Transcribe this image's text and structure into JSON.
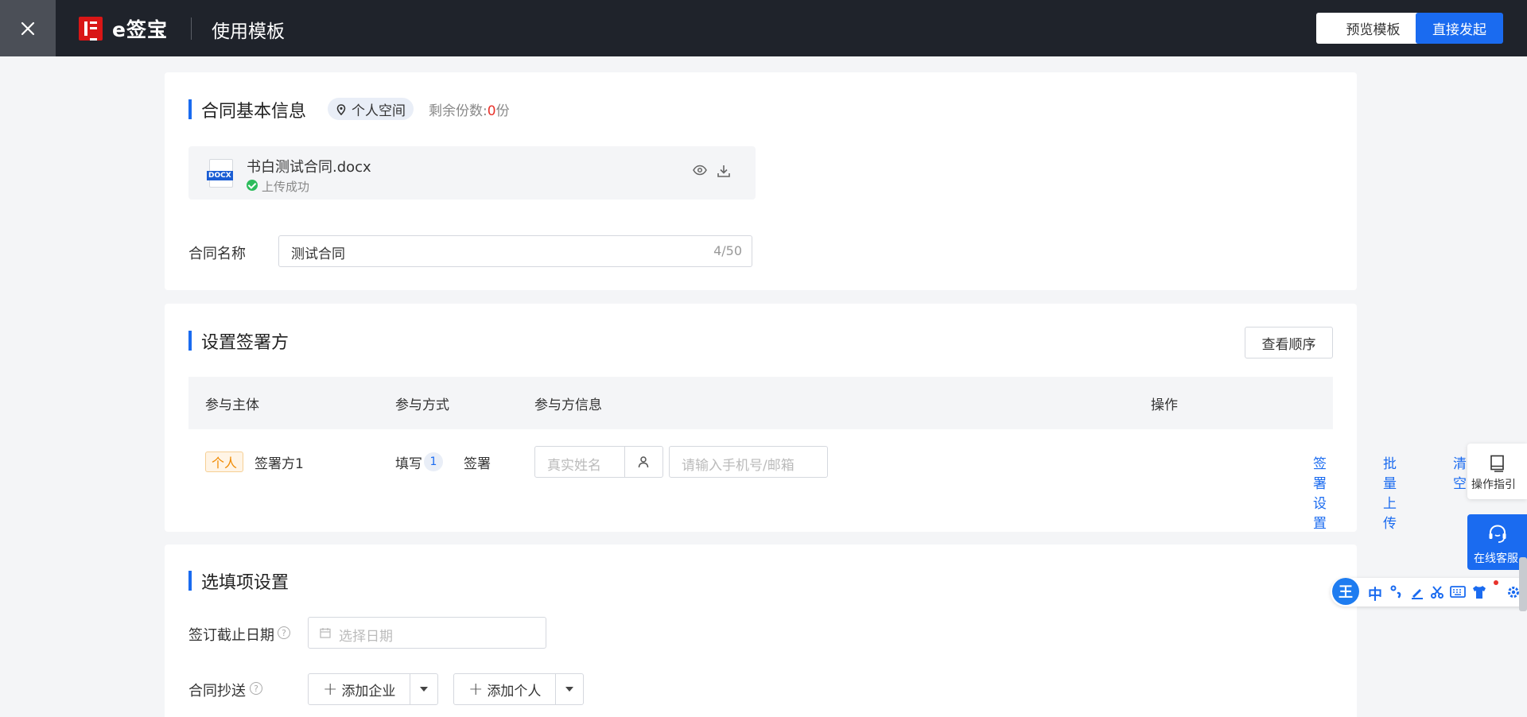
{
  "header": {
    "brand": "e签宝",
    "page_title": "使用模板",
    "preview_label": "预览模板",
    "send_label": "直接发起"
  },
  "basic_info": {
    "title": "合同基本信息",
    "space_tag": "个人空间",
    "remain_label": "剩余份数:",
    "remain_count": "0",
    "remain_unit": "份",
    "file": {
      "icon_label": "DOCX",
      "name": "书白测试合同.docx",
      "status": "上传成功"
    },
    "contract_name_label": "合同名称",
    "contract_name_value": "测试合同",
    "contract_name_count": "4/50"
  },
  "signers": {
    "title": "设置签署方",
    "order_button": "查看顺序",
    "columns": [
      "参与主体",
      "参与方式",
      "参与方信息",
      "操作"
    ],
    "row": {
      "type_tag": "个人",
      "name": "签署方1",
      "fill_label": "填写",
      "fill_count": "1",
      "sign_label": "签署",
      "name_placeholder": "真实姓名",
      "phone_placeholder": "请输入手机号/邮箱",
      "actions": [
        "签署设置",
        "批量上传",
        "清空"
      ]
    }
  },
  "options": {
    "title": "选填项设置",
    "deadline_label": "签订截止日期",
    "date_placeholder": "选择日期",
    "cc_label": "合同抄送",
    "add_company": "添加企业",
    "add_person": "添加个人"
  },
  "float": {
    "guide_label": "操作指引",
    "service_label": "在线客服"
  },
  "ime": {
    "logo": "王",
    "mode": "中"
  },
  "colors": {
    "accent": "#1a6bf0",
    "header_bg": "#1f232b",
    "danger": "#e8322b",
    "success": "#2dbc5c",
    "person_tag": "#f08a00"
  }
}
